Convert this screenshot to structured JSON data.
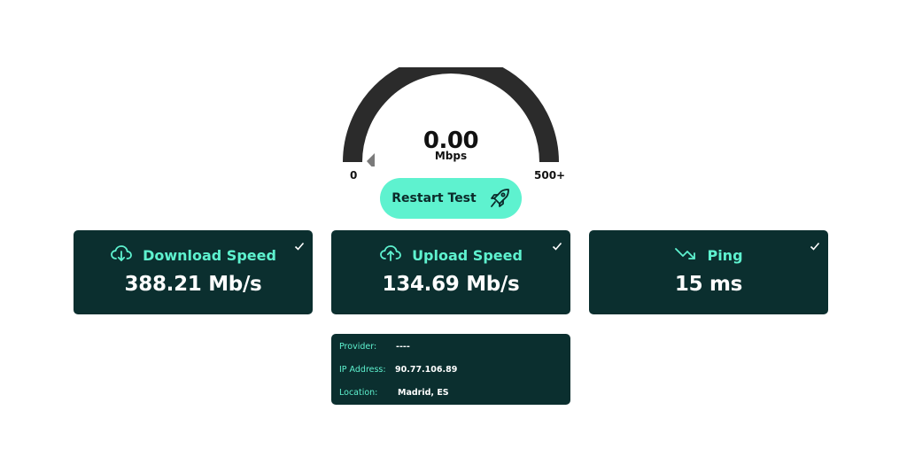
{
  "gauge": {
    "value": "0.00",
    "unit": "Mbps",
    "min_label": "0",
    "max_label": "500+",
    "level_fraction": 0.0
  },
  "restart_button": {
    "label": "Restart Test",
    "icon": "rocket-icon"
  },
  "cards": [
    {
      "title": "Download Speed",
      "value": "388.21 Mb/s",
      "icon": "cloud-download-icon",
      "status": "check-icon"
    },
    {
      "title": "Upload Speed",
      "value": "134.69 Mb/s",
      "icon": "cloud-upload-icon",
      "status": "check-icon"
    },
    {
      "title": "Ping",
      "value": "15 ms",
      "icon": "trend-up-icon",
      "status": "check-icon"
    }
  ],
  "info": {
    "provider_label": "Provider:",
    "provider_value": "----",
    "ip_label": "IP Address:",
    "ip_value": "90.77.106.89",
    "location_label": "Location:",
    "location_value": "Madrid, ES"
  },
  "colors": {
    "accent": "#5ef2cf",
    "card_bg": "#0b2f2f",
    "gauge_track": "#2b2b2b",
    "needle": "#7a7a7a"
  }
}
